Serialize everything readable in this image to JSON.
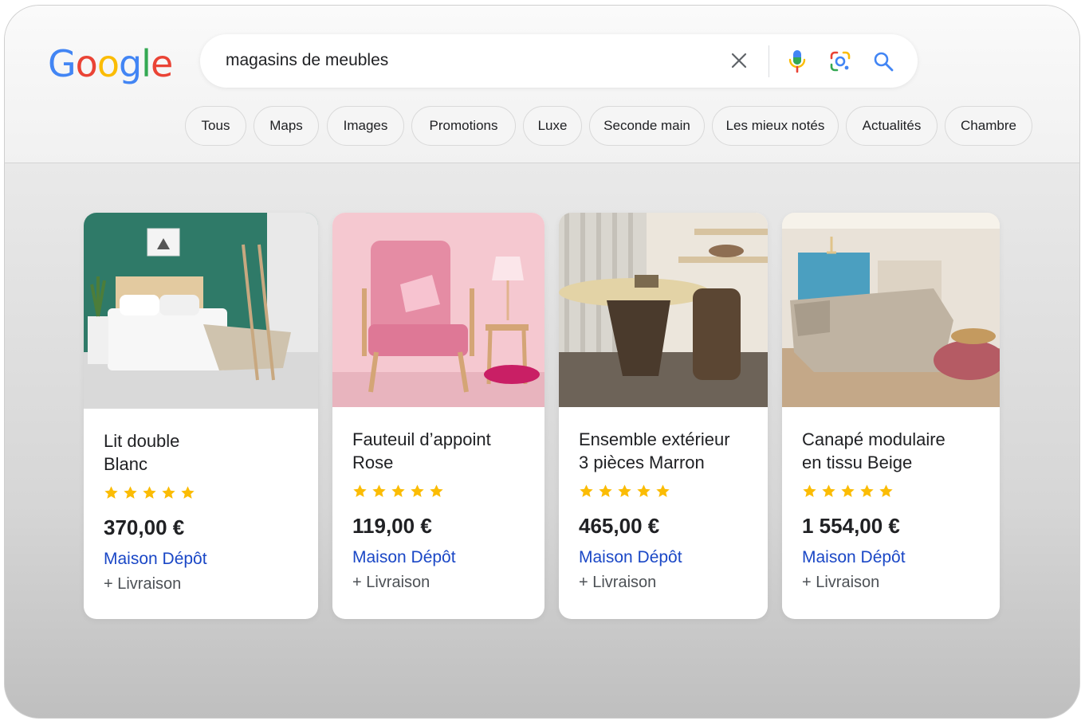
{
  "logo": {
    "letters": [
      "G",
      "o",
      "o",
      "g",
      "l",
      "e"
    ],
    "colors": [
      "#4285F4",
      "#EA4335",
      "#FBBC05",
      "#4285F4",
      "#34A853",
      "#EA4335"
    ]
  },
  "search": {
    "query": "magasins de meubles",
    "icons": [
      "close-icon",
      "mic-icon",
      "lens-icon",
      "search-icon"
    ]
  },
  "chips": [
    {
      "label": "Tous"
    },
    {
      "label": "Maps"
    },
    {
      "label": "Images"
    },
    {
      "label": "Promotions"
    },
    {
      "label": "Luxe"
    },
    {
      "label": "Seconde main"
    },
    {
      "label": "Les mieux notés"
    },
    {
      "label": "Actualités"
    },
    {
      "label": "Chambre"
    }
  ],
  "products": [
    {
      "title_line1": "Lit double",
      "title_line2": "Blanc",
      "rating": 5,
      "price": "370,00 €",
      "seller": "Maison Dépôt",
      "shipping": "+ Livraison"
    },
    {
      "title_line1": "Fauteuil d’appoint",
      "title_line2": "Rose",
      "rating": 5,
      "price": "119,00 €",
      "seller": "Maison Dépôt",
      "shipping": "+ Livraison"
    },
    {
      "title_line1": "Ensemble extérieur",
      "title_line2": "3 pièces Marron",
      "rating": 5,
      "price": "465,00 €",
      "seller": "Maison Dépôt",
      "shipping": "+ Livraison"
    },
    {
      "title_line1": "Canapé modulaire",
      "title_line2": "en tissu Beige",
      "rating": 5,
      "price": "1 554,00 €",
      "seller": "Maison Dépôt",
      "shipping": "+ Livraison"
    }
  ],
  "colors": {
    "star": "#FBBC04",
    "link": "#1a47c6"
  }
}
